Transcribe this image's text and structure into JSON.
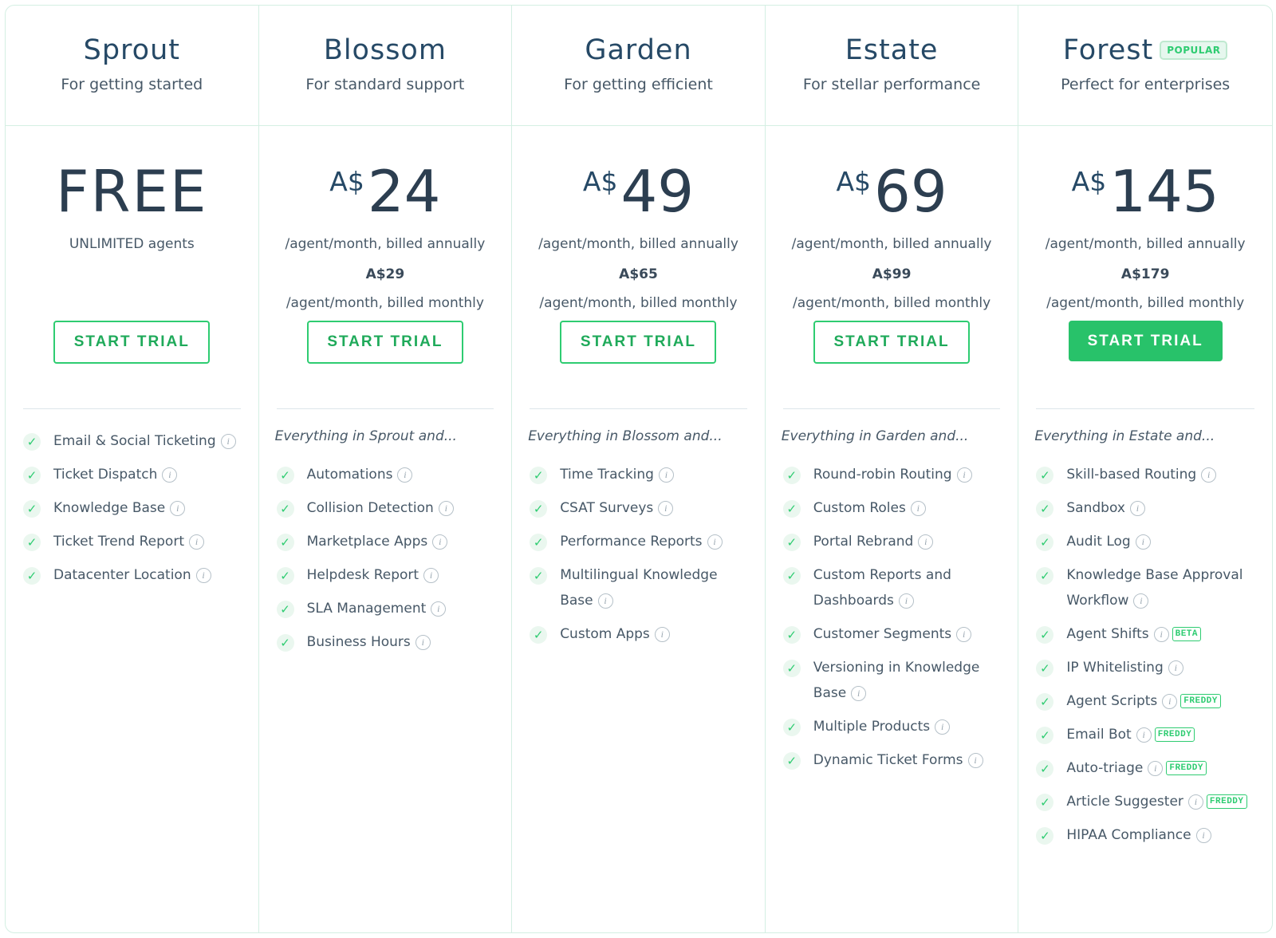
{
  "plans": [
    {
      "name": "Sprout",
      "tagline": "For getting started",
      "price": "FREE",
      "billing": "UNLIMITED agents",
      "cta": "START TRIAL",
      "features": [
        {
          "label": "Email & Social Ticketing"
        },
        {
          "label": "Ticket Dispatch"
        },
        {
          "label": "Knowledge Base"
        },
        {
          "label": "Ticket Trend Report"
        },
        {
          "label": "Datacenter Location"
        }
      ]
    },
    {
      "name": "Blossom",
      "tagline": "For standard support",
      "currency": "A$",
      "price": "24",
      "billing": "/agent/month, billed annually",
      "monthly_price": "A$29",
      "monthly_billing": "/agent/month, billed monthly",
      "cta": "START TRIAL",
      "intro": "Everything in Sprout and...",
      "features": [
        {
          "label": "Automations"
        },
        {
          "label": "Collision Detection"
        },
        {
          "label": "Marketplace Apps"
        },
        {
          "label": "Helpdesk Report"
        },
        {
          "label": "SLA Management"
        },
        {
          "label": "Business Hours"
        }
      ]
    },
    {
      "name": "Garden",
      "tagline": "For getting efficient",
      "currency": "A$",
      "price": "49",
      "billing": "/agent/month, billed annually",
      "monthly_price": "A$65",
      "monthly_billing": "/agent/month, billed monthly",
      "cta": "START TRIAL",
      "intro": "Everything in Blossom and...",
      "features": [
        {
          "label": "Time Tracking"
        },
        {
          "label": "CSAT Surveys"
        },
        {
          "label": "Performance Reports"
        },
        {
          "label": "Multilingual Knowledge Base"
        },
        {
          "label": "Custom Apps"
        }
      ]
    },
    {
      "name": "Estate",
      "tagline": "For stellar performance",
      "currency": "A$",
      "price": "69",
      "billing": "/agent/month, billed annually",
      "monthly_price": "A$99",
      "monthly_billing": "/agent/month, billed monthly",
      "cta": "START TRIAL",
      "intro": "Everything in Garden and...",
      "features": [
        {
          "label": "Round-robin Routing"
        },
        {
          "label": "Custom Roles"
        },
        {
          "label": "Portal Rebrand"
        },
        {
          "label": "Custom Reports and Dashboards"
        },
        {
          "label": "Customer Segments"
        },
        {
          "label": "Versioning in Knowledge Base"
        },
        {
          "label": "Multiple Products"
        },
        {
          "label": "Dynamic Ticket Forms"
        }
      ]
    },
    {
      "name": "Forest",
      "tagline": "Perfect for enterprises",
      "badge": "POPULAR",
      "currency": "A$",
      "price": "145",
      "billing": "/agent/month, billed annually",
      "monthly_price": "A$179",
      "monthly_billing": "/agent/month, billed monthly",
      "cta": "START TRIAL",
      "intro": "Everything in Estate and...",
      "features": [
        {
          "label": "Skill-based Routing"
        },
        {
          "label": "Sandbox"
        },
        {
          "label": "Audit Log"
        },
        {
          "label": "Knowledge Base Approval Workflow"
        },
        {
          "label": "Agent Shifts",
          "tag": "BETA"
        },
        {
          "label": "IP Whitelisting"
        },
        {
          "label": "Agent Scripts",
          "tag": "FREDDY"
        },
        {
          "label": "Email Bot",
          "tag": "FREDDY"
        },
        {
          "label": "Auto-triage",
          "tag": "FREDDY"
        },
        {
          "label": "Article Suggester",
          "tag": "FREDDY"
        },
        {
          "label": "HIPAA Compliance"
        }
      ]
    }
  ],
  "icons": {
    "check": "check-icon",
    "info": "info-icon"
  },
  "colors": {
    "accent": "#2ecc71",
    "border": "#d4efe3",
    "text": "#475867"
  }
}
